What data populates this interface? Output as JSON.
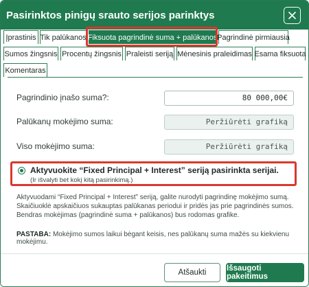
{
  "dialog": {
    "title": "Pasirinktos pinigų srauto serijos parinktys",
    "close_icon": "close-icon"
  },
  "tabs": [
    {
      "label": "Įprastinis",
      "active": false
    },
    {
      "label": "Tik palūkanos",
      "active": false
    },
    {
      "label": "Fiksuota pagrindinė suma + palūkanos",
      "active": true
    },
    {
      "label": "Pagrindinė pirmiausia",
      "active": false
    },
    {
      "label": "Sumos žingsnis",
      "active": false
    },
    {
      "label": "Procentų žingsnis",
      "active": false
    },
    {
      "label": "Praleisti seriją",
      "active": false
    },
    {
      "label": "Mėnesinis praleidimas",
      "active": false
    },
    {
      "label": "Esama fiksuota",
      "active": false
    },
    {
      "label": "Komentaras",
      "active": false
    }
  ],
  "fields": {
    "principal": {
      "label": "Pagrindinio įnašo suma?:",
      "value": "80 000,00€"
    },
    "interest": {
      "label": "Palūkanų mokėjimo suma:",
      "value": "Peržiūrėti grafiką"
    },
    "total": {
      "label": "Viso mokėjimo suma:",
      "value": "Peržiūrėti grafiką"
    }
  },
  "option": {
    "title": "Aktyvuokite “Fixed Principal + Interest” seriją pasirinkta serijai.",
    "subtitle": "(Ir išvalyti bet kokį kitą pasirinkimą.)",
    "selected": true
  },
  "description": "Aktyvuodami “Fixed Principal + Interest” seriją, galite nurodyti pagrindinę mokėjimo sumą. Skaičiuoklė apskaičiuos sukauptas palūkanas periodui ir pridės jas prie pagrindinės sumos. Bendras mokėjimas (pagrindinė suma + palūkanos) bus rodomas grafike.",
  "note": {
    "label": "PASTABA:",
    "text": " Mokėjimo sumos laikui bėgant keisis, nes palūkanų suma mažės su kiekvienu mokėjimu."
  },
  "buttons": {
    "cancel": "Atšaukti",
    "save": "Išsaugoti pakeitimus"
  },
  "colors": {
    "accent": "#1f7a4f",
    "highlight": "#d9382c"
  }
}
